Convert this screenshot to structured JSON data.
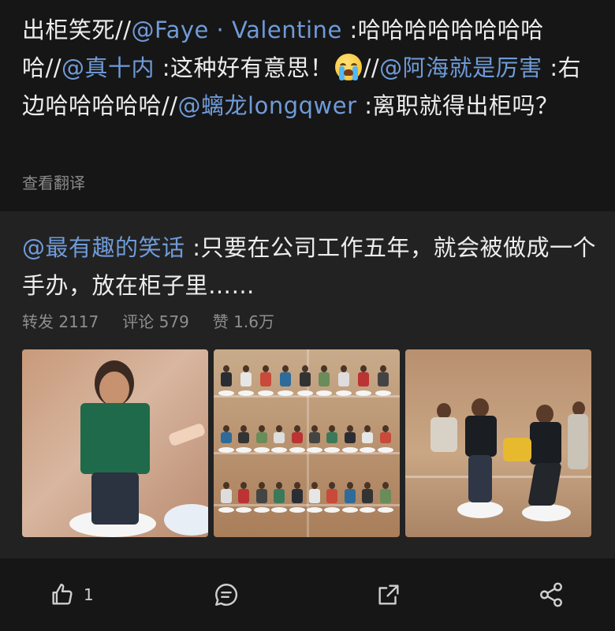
{
  "post": {
    "segments": [
      {
        "t": "出柜笑死//",
        "c": "text"
      },
      {
        "t": "@Faye · Valentine",
        "c": "mention"
      },
      {
        "t": " :哈哈哈哈哈哈哈哈哈//",
        "c": "text"
      },
      {
        "t": "@真十内",
        "c": "mention"
      },
      {
        "t": " :这种好有意思！",
        "c": "text"
      },
      {
        "t": "[emoji]",
        "c": "emoji"
      },
      {
        "t": "//",
        "c": "text"
      },
      {
        "t": "@阿海就是厉害",
        "c": "mention"
      },
      {
        "t": " :右边哈哈哈哈哈//",
        "c": "text"
      },
      {
        "t": "@螭龙longqwer",
        "c": "mention"
      },
      {
        "t": " :离职就得出柜吗？",
        "c": "text"
      }
    ],
    "translate_label": "查看翻译"
  },
  "repost": {
    "author": "@最有趣的笑话",
    "text": " :只要在公司工作五年，就会被做成一个手办，放在柜子里……",
    "stats": {
      "repost": "转发 2117",
      "comment": "评论 579",
      "like": "赞 1.6万"
    }
  },
  "actions": {
    "like_count": "1"
  },
  "colors": {
    "background": "#161616",
    "repost_bg": "#222222",
    "mention": "#6f9bd8",
    "text": "#ededed",
    "muted": "#8a8a8a"
  },
  "icons": [
    "thumbs-up-icon",
    "comment-icon",
    "repost-icon",
    "share-icon",
    "crying-emoji-icon"
  ]
}
